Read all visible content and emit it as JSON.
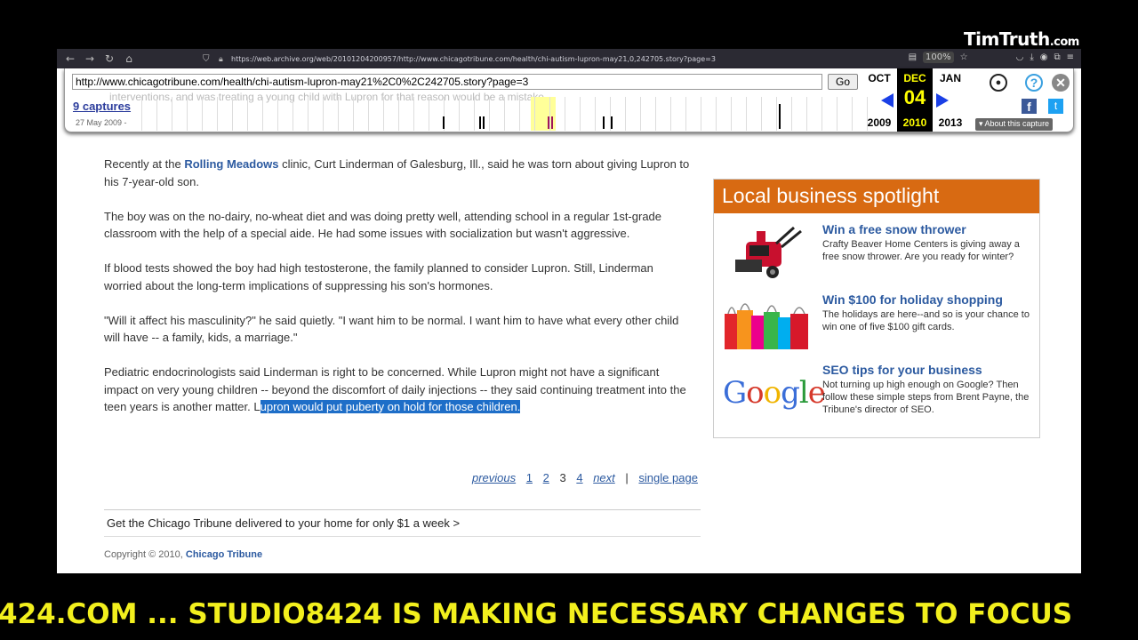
{
  "overlay": {
    "logo_main": "TimTruth",
    "logo_suffix": ".com",
    "ticker": "424.COM ...    STUDIO8424 IS MAKING NECESSARY CHANGES TO FOCUS"
  },
  "browser": {
    "address": "https://web.archive.org/web/20101204200957/http://www.chicagotribune.com/health/chi-autism-lupron-may21,0,242705.story?page=3",
    "zoom": "100%",
    "icons": [
      "back-icon",
      "forward-icon",
      "reload-icon",
      "home-icon",
      "shield-icon",
      "lock-icon",
      "reader-icon",
      "star-icon",
      "pocket-icon",
      "download-icon",
      "account-icon",
      "extensions-icon",
      "menu-icon"
    ]
  },
  "wayback": {
    "url_value": "http://www.chicagotribune.com/health/chi-autism-lupron-may21%2C0%2C242705.story?page=3",
    "go_label": "Go",
    "captures_label": "9 captures",
    "first_capture": "27 May 2009 -",
    "ghost_text": "interventions, and was treating a young child with Lupron for that reason would be a mistake.",
    "prev_month": "OCT",
    "prev_year": "2009",
    "cur_month": "DEC",
    "cur_day": "04",
    "cur_year": "2010",
    "next_month": "JAN",
    "next_year": "2013",
    "about_label": "▾ About this capture"
  },
  "article": {
    "p1_pre": "Recently at the ",
    "p1_link": "Rolling Meadows",
    "p1_post": " clinic, Curt Linderman of Galesburg, Ill., said he was torn about giving Lupron to his 7-year-old son.",
    "p2": "The boy was on the no-dairy, no-wheat diet and was doing pretty well, attending school in a regular 1st-grade classroom with the help of a special aide. He had some issues with socialization but wasn't aggressive.",
    "p3": "If blood tests showed the boy had high testosterone, the family planned to consider Lupron. Still, Linderman worried about the long-term implications of suppressing his son's hormones.",
    "p4": "\"Will it affect his masculinity?\" he said quietly. \"I want him to be normal. I want him to have what every other child will have -- a family, kids, a marriage.\"",
    "p5_pre": "Pediatric endocrinologists said Linderman is right to be concerned. While Lupron might not have a significant impact on very young children -- beyond the discomfort of daily injections -- they said continuing treatment into the teen years is another matter. L",
    "p5_selected": "upron would put puberty on hold for those children."
  },
  "pager": {
    "previous": "previous",
    "p1": "1",
    "p2": "2",
    "p3": "3",
    "p4": "4",
    "next": "next",
    "sep": "|",
    "single": "single page"
  },
  "footer": {
    "subscribe": "Get the Chicago Tribune delivered to your home for only $1 a week >",
    "copyright_pre": "Copyright © 2010, ",
    "copyright_link": "Chicago Tribune"
  },
  "spotlight": {
    "header": "Local business spotlight",
    "items": [
      {
        "title": "Win a free snow thrower",
        "desc": "Crafty Beaver Home Centers is giving away a free snow thrower. Are you ready for winter?"
      },
      {
        "title": "Win $100 for holiday shopping",
        "desc": "The holidays are here--and so is your chance to win one of five $100 gift cards."
      },
      {
        "title": "SEO tips for your business",
        "desc": "Not turning up high enough on Google? Then follow these simple steps from Brent Payne, the Tribune's director of SEO.",
        "logo_text": "Google"
      }
    ]
  }
}
